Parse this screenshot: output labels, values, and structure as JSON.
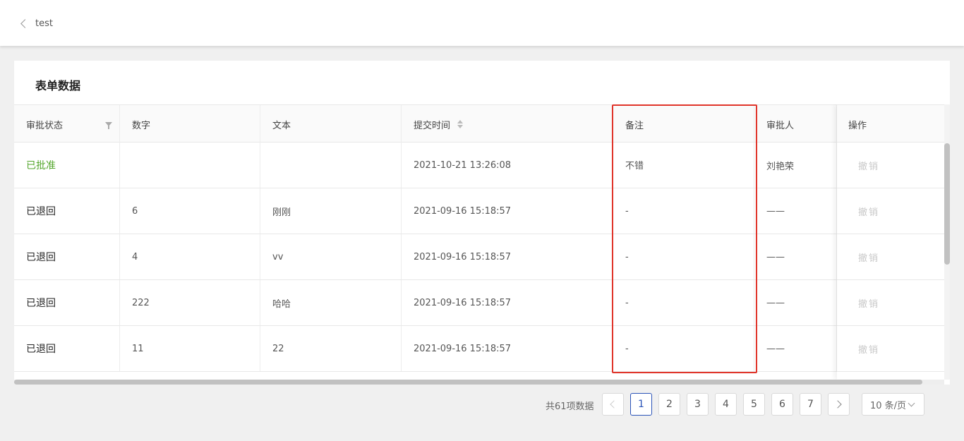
{
  "header": {
    "back_label": "test"
  },
  "card": {
    "title": "表单数据"
  },
  "table": {
    "columns": [
      "审批状态",
      "数字",
      "文本",
      "提交时间",
      "备注",
      "审批人",
      "操作"
    ],
    "rows": [
      {
        "status": "已批准",
        "number": "",
        "text": "",
        "submitted": "2021-10-21 13:26:08",
        "remark": "不错",
        "approver": "刘艳荣",
        "action": "撤销"
      },
      {
        "status": "已退回",
        "number": "6",
        "text": "刚刚",
        "submitted": "2021-09-16 15:18:57",
        "remark": "-",
        "approver": "——",
        "action": "撤销"
      },
      {
        "status": "已退回",
        "number": "4",
        "text": "vv",
        "submitted": "2021-09-16 15:18:57",
        "remark": "-",
        "approver": "——",
        "action": "撤销"
      },
      {
        "status": "已退回",
        "number": "222",
        "text": "哈哈",
        "submitted": "2021-09-16 15:18:57",
        "remark": "-",
        "approver": "——",
        "action": "撤销"
      },
      {
        "status": "已退回",
        "number": "11",
        "text": "22",
        "submitted": "2021-09-16 15:18:57",
        "remark": "-",
        "approver": "——",
        "action": "撤销"
      }
    ]
  },
  "pagination": {
    "total_text": "共61项数据",
    "pages": [
      "1",
      "2",
      "3",
      "4",
      "5",
      "6",
      "7"
    ],
    "current": "1",
    "page_size": "10 条/页"
  },
  "colors": {
    "approved": "#52a52a",
    "highlight": "#e0352b",
    "active_page": "#2b54b8"
  },
  "icons": [
    "chevron-left-icon",
    "filter-icon",
    "sort-icon",
    "chevron-right-icon",
    "chevron-down-icon"
  ]
}
